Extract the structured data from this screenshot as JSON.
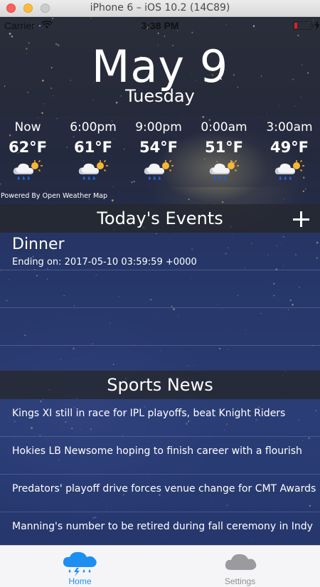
{
  "window": {
    "title": "iPhone 6 – iOS 10.2 (14C89)"
  },
  "status_bar": {
    "carrier": "Carrier",
    "time": "3:38 PM"
  },
  "header": {
    "date": "May 9",
    "weekday": "Tuesday"
  },
  "forecast": [
    {
      "time": "Now",
      "temp": "62°F",
      "icon": "rain-sun-cloud-icon"
    },
    {
      "time": "6:00pm",
      "temp": "61°F",
      "icon": "rain-sun-cloud-icon"
    },
    {
      "time": "9:00pm",
      "temp": "54°F",
      "icon": "rain-sun-cloud-icon"
    },
    {
      "time": "0:00am",
      "temp": "51°F",
      "icon": "rain-sun-cloud-icon"
    },
    {
      "time": "3:00am",
      "temp": "49°F",
      "icon": "rain-sun-cloud-icon"
    }
  ],
  "powered_by": "Powered By Open Weather Map",
  "events": {
    "title": "Today's Events",
    "items": [
      {
        "title": "Dinner",
        "subtitle": "Ending on: 2017-05-10 03:59:59 +0000"
      }
    ]
  },
  "news": {
    "title": "Sports News",
    "items": [
      "Kings XI still in race for IPL playoffs, beat Knight Riders",
      "Hokies LB Newsome hoping to finish career with a flourish",
      "Predators' playoff drive forces venue change for CMT Awards",
      "Manning's number to be retired during fall ceremony in Indy"
    ]
  },
  "tab_bar": {
    "items": [
      {
        "label": "Home",
        "icon": "storm-cloud-icon",
        "selected": true,
        "color": "#1e8ef0"
      },
      {
        "label": "Settings",
        "icon": "cloud-icon",
        "selected": false,
        "color": "#8e8e93"
      }
    ]
  }
}
